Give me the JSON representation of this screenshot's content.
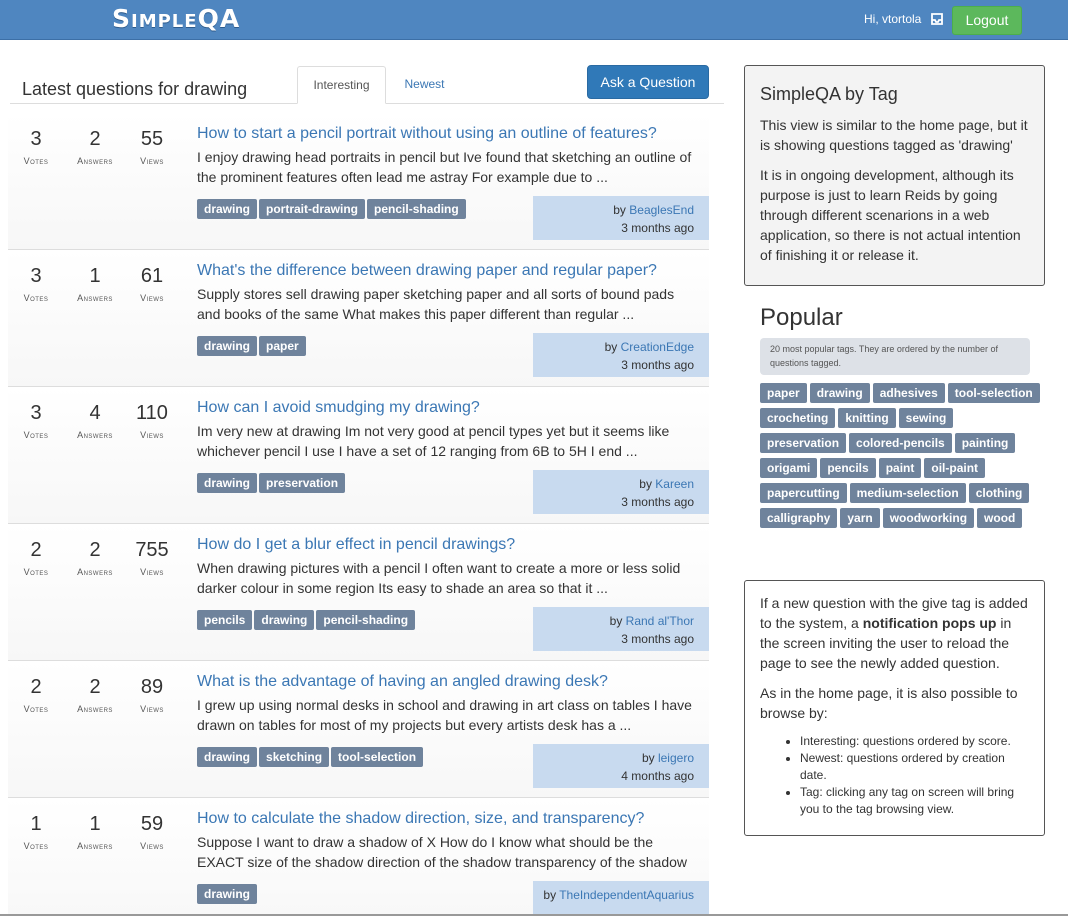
{
  "navbar": {
    "brand": "SimpleQA",
    "greeting": "Hi, vtortola",
    "logout_label": "Logout"
  },
  "main": {
    "heading": "Latest questions for drawing",
    "tabs": [
      {
        "label": "Interesting",
        "active": true
      },
      {
        "label": "Newest",
        "active": false
      }
    ],
    "ask_label": "Ask a Question",
    "stat_labels": {
      "votes": "Votes",
      "answers": "Answers",
      "views": "Views"
    },
    "questions": [
      {
        "votes": "3",
        "answers": "2",
        "views": "55",
        "title": "How to start a pencil portrait without using an outline of features?",
        "excerpt": "I enjoy drawing head portraits in pencil but Ive found that sketching an outline of the prominent features often lead me astray For example due to ...",
        "tags": [
          "drawing",
          "portrait-drawing",
          "pencil-shading"
        ],
        "by_prefix": "by",
        "user": "BeaglesEnd",
        "time": "3 months ago"
      },
      {
        "votes": "3",
        "answers": "1",
        "views": "61",
        "title": "What's the difference between drawing paper and regular paper?",
        "excerpt": "Supply stores sell drawing paper sketching paper and all sorts of bound pads and books of the same What makes this paper different than regular ...",
        "tags": [
          "drawing",
          "paper"
        ],
        "by_prefix": "by",
        "user": "CreationEdge",
        "time": "3 months ago"
      },
      {
        "votes": "3",
        "answers": "4",
        "views": "110",
        "title": "How can I avoid smudging my drawing?",
        "excerpt": "Im very new at drawing Im not very good at pencil types yet but it seems like whichever pencil I use I have a set of 12 ranging from 6B to 5H I end ...",
        "tags": [
          "drawing",
          "preservation"
        ],
        "by_prefix": "by",
        "user": "Kareen",
        "time": "3 months ago"
      },
      {
        "votes": "2",
        "answers": "2",
        "views": "755",
        "title": "How do I get a blur effect in pencil drawings?",
        "excerpt": "When drawing pictures with a pencil I often want to create a more or less solid darker colour in some region Its easy to shade an area so that it ...",
        "tags": [
          "pencils",
          "drawing",
          "pencil-shading"
        ],
        "by_prefix": "by",
        "user": "Rand al'Thor",
        "time": "3 months ago"
      },
      {
        "votes": "2",
        "answers": "2",
        "views": "89",
        "title": "What is the advantage of having an angled drawing desk?",
        "excerpt": "I grew up using normal desks in school and drawing in art class on tables I have drawn on tables for most of my projects but every artists desk has a ...",
        "tags": [
          "drawing",
          "sketching",
          "tool-selection"
        ],
        "by_prefix": "by",
        "user": "leigero",
        "time": "4 months ago"
      },
      {
        "votes": "1",
        "answers": "1",
        "views": "59",
        "title": "How to calculate the shadow direction, size, and transparency?",
        "excerpt": "Suppose I want to draw a shadow of X How do I know what should be the EXACT size of the shadow direction of the shadow transparency of the shadow ...",
        "tags": [
          "drawing"
        ],
        "by_prefix": "by",
        "user": "TheIndependentAquarius",
        "time": ""
      }
    ]
  },
  "sidebar": {
    "info": {
      "title": "SimpleQA by Tag",
      "p1": "This view is similar to the home page, but it is showing questions tagged as 'drawing'",
      "p2": "It is in ongoing development, although its purpose is just to learn Reids by going through different scenarions in a web application, so there is not actual intention of finishing it or release it."
    },
    "popular": {
      "title": "Popular",
      "note": "20 most popular tags. They are ordered by the number of questions tagged.",
      "tags": [
        "paper",
        "drawing",
        "adhesives",
        "tool-selection",
        "crocheting",
        "knitting",
        "sewing",
        "preservation",
        "colored-pencils",
        "painting",
        "origami",
        "pencils",
        "paint",
        "oil-paint",
        "papercutting",
        "medium-selection",
        "clothing",
        "calligraphy",
        "yarn",
        "woodworking",
        "wood"
      ]
    },
    "notes": {
      "p1_before": "If a new question with the give tag is added to the system, a ",
      "p1_bold": "notification pops up",
      "p1_after": " in the screen inviting the user to reload the page to see the newly added question.",
      "p2": "As in the home page, it is also possible to browse by:",
      "items": [
        "Interesting: questions ordered by score.",
        "Newest: questions ordered by creation date.",
        "Tag: clicking any tag on screen will bring you to the tag browsing view."
      ]
    }
  }
}
